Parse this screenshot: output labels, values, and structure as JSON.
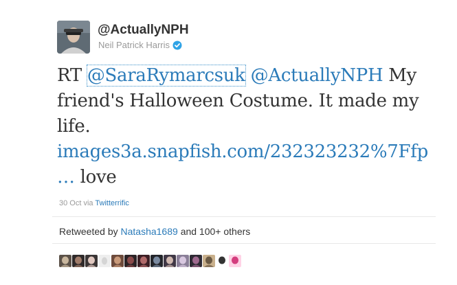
{
  "tweet": {
    "handle": "@ActuallyNPH",
    "full_name": "Neil Patrick Harris",
    "verified_icon": "verified-badge-icon",
    "text_prefix": "RT",
    "mention_1": "@SaraRymarcsuk",
    "mention_2": "@ActuallyNPH",
    "text_body": "My friend's Halloween Costume. It made my life.",
    "link_text": "images3a.snapfish.com/232323232%7Ffp",
    "link_continuation": "…",
    "text_suffix": "love",
    "date": "30 Oct",
    "via_label": "via",
    "client": "Twitterrific"
  },
  "retweets": {
    "prefix": "Retweeted by",
    "user": "Natasha1689",
    "suffix": "and 100+ others",
    "avatars": [
      {
        "name": "retweeter-avatar-1",
        "bg": "#5b5148",
        "fg": "#c9b79e"
      },
      {
        "name": "retweeter-avatar-2",
        "bg": "#2f2a2a",
        "fg": "#a07c6a"
      },
      {
        "name": "retweeter-avatar-3",
        "bg": "#3a3535",
        "fg": "#e0c8c0"
      },
      {
        "name": "retweeter-avatar-4",
        "bg": "#eeeeee",
        "fg": "#d5d5d5"
      },
      {
        "name": "retweeter-avatar-5",
        "bg": "#6d4b3c",
        "fg": "#c99a7a"
      },
      {
        "name": "retweeter-avatar-6",
        "bg": "#2b2326",
        "fg": "#8a4a4a"
      },
      {
        "name": "retweeter-avatar-7",
        "bg": "#3c1f25",
        "fg": "#b06a6a"
      },
      {
        "name": "retweeter-avatar-8",
        "bg": "#23252a",
        "fg": "#7a8aa0"
      },
      {
        "name": "retweeter-avatar-9",
        "bg": "#403846",
        "fg": "#cfb8b0"
      },
      {
        "name": "retweeter-avatar-10",
        "bg": "#8a7f98",
        "fg": "#d8c8e0"
      },
      {
        "name": "retweeter-avatar-11",
        "bg": "#2e2a34",
        "fg": "#9f6a8f"
      },
      {
        "name": "retweeter-avatar-12",
        "bg": "#c9b08c",
        "fg": "#6b5a44"
      },
      {
        "name": "retweeter-avatar-13",
        "bg": "#ffffff",
        "fg": "#333333"
      },
      {
        "name": "retweeter-avatar-14",
        "bg": "#ffd3e6",
        "fg": "#d43d7e"
      }
    ]
  },
  "colors": {
    "link": "#2b7bb9",
    "text": "#333333",
    "muted": "#999999",
    "verified": "#2fa3e6"
  }
}
